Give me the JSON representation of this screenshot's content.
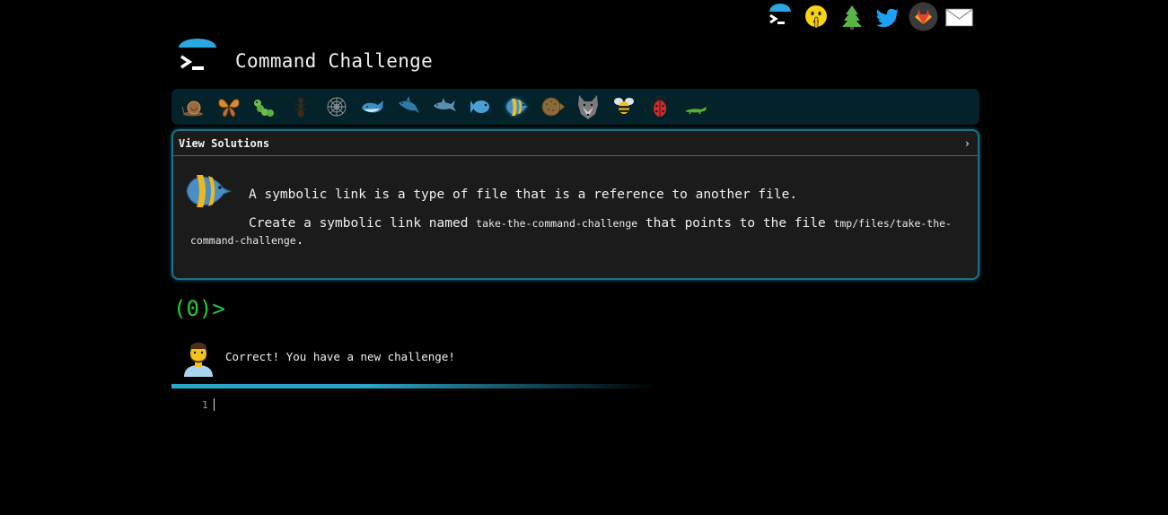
{
  "header": {
    "title": "Command Challenge"
  },
  "social": {
    "items": [
      {
        "name": "terminal-logo-icon"
      },
      {
        "name": "shush-emoji-icon"
      },
      {
        "name": "tree-icon"
      },
      {
        "name": "twitter-icon"
      },
      {
        "name": "gitlab-icon"
      },
      {
        "name": "mail-icon"
      }
    ]
  },
  "levels": [
    {
      "name": "snail-icon"
    },
    {
      "name": "butterfly-icon"
    },
    {
      "name": "caterpillar-icon"
    },
    {
      "name": "ant-icon"
    },
    {
      "name": "spider-web-icon"
    },
    {
      "name": "whale-icon"
    },
    {
      "name": "shark-icon"
    },
    {
      "name": "dolphin-icon"
    },
    {
      "name": "fish-icon"
    },
    {
      "name": "tropical-fish-icon",
      "active": true
    },
    {
      "name": "blowfish-icon"
    },
    {
      "name": "wolf-icon"
    },
    {
      "name": "bee-icon"
    },
    {
      "name": "ladybug-icon"
    },
    {
      "name": "lizard-icon"
    }
  ],
  "challenge": {
    "solutions_label": "View Solutions",
    "chevron": "›",
    "line1": "A symbolic link is a type of file that is a reference to another file.",
    "line2_prefix": "Create a symbolic link named ",
    "line2_code1": "take-the-command-challenge",
    "line2_middle": " that points to the file ",
    "line2_code2": "tmp/files/take-the-command-challenge",
    "line2_suffix": "."
  },
  "prompt": "(0)>",
  "feedback": {
    "message": "Correct! You have a new challenge!"
  },
  "editor": {
    "line_number": "1"
  },
  "colors": {
    "accent": "#1b6f8a",
    "progress": "#2aa6c8",
    "prompt_green": "#27c93f",
    "level_bar": "#04222a"
  }
}
